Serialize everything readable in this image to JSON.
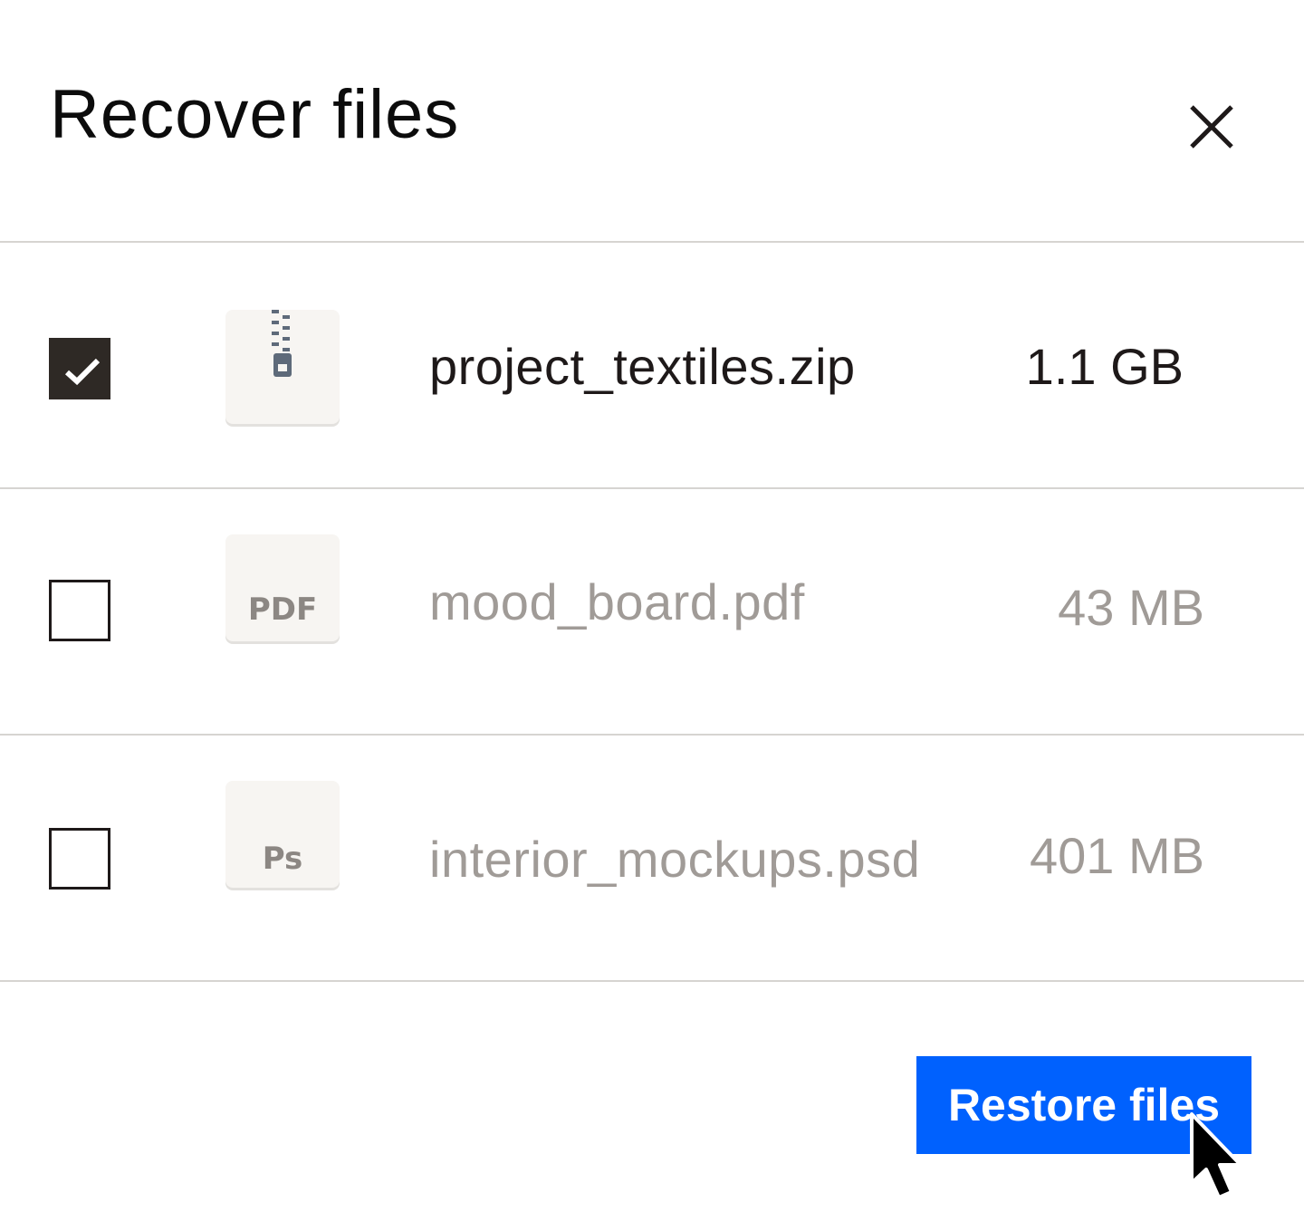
{
  "dialog": {
    "title": "Recover files",
    "close_icon": "close-icon"
  },
  "files": [
    {
      "name": "project_textiles.zip",
      "size": "1.1 GB",
      "checked": true,
      "type": "zip",
      "thumb_label": "",
      "icon": "zip-file-icon"
    },
    {
      "name": "mood_board.pdf",
      "size": "43 MB",
      "checked": false,
      "type": "pdf",
      "thumb_label": "PDF",
      "icon": "pdf-file-icon"
    },
    {
      "name": "interior_mockups.psd",
      "size": "401 MB",
      "checked": false,
      "type": "psd",
      "thumb_label": "Ps",
      "icon": "psd-file-icon"
    }
  ],
  "footer": {
    "restore_label": "Restore files"
  },
  "colors": {
    "accent": "#0061fe",
    "checked_box": "#2e2925",
    "divider": "#d6d4d1",
    "muted_text": "#a09b97"
  }
}
